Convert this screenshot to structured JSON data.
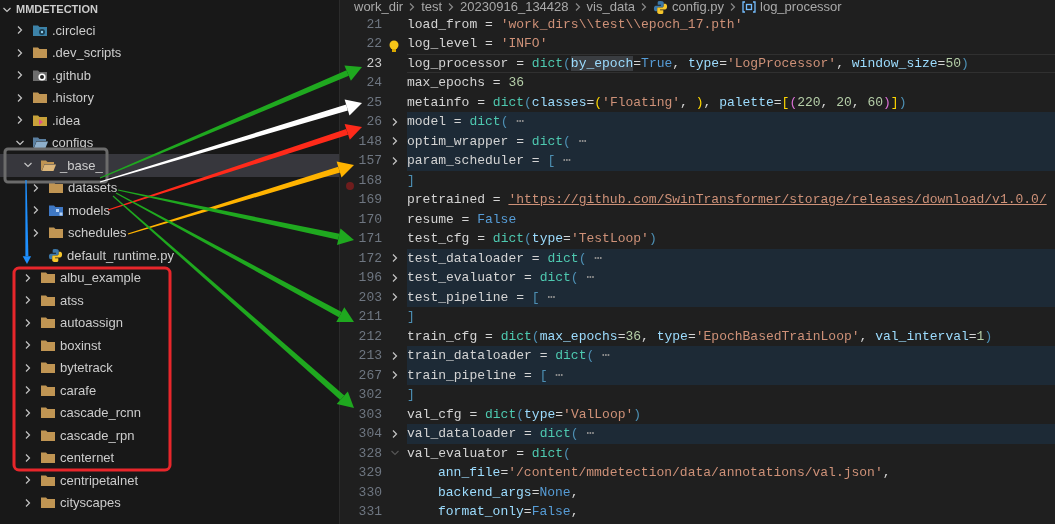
{
  "explorer": {
    "title": "MMDETECTION",
    "expanded": true,
    "items": [
      {
        "label": ".circleci",
        "kind": "folder-circleci",
        "expanded": false,
        "selected": false
      },
      {
        "label": ".dev_scripts",
        "kind": "folder",
        "expanded": false,
        "selected": false
      },
      {
        "label": ".github",
        "kind": "folder-github",
        "expanded": false,
        "selected": false
      },
      {
        "label": ".history",
        "kind": "folder",
        "expanded": false,
        "selected": false
      },
      {
        "label": ".idea",
        "kind": "folder-idea",
        "expanded": false,
        "selected": false
      },
      {
        "label": "configs",
        "kind": "folder-config",
        "expanded": true,
        "selected": false,
        "children": [
          {
            "label": "_base_",
            "kind": "folder",
            "expanded": true,
            "selected": true,
            "children": [
              {
                "label": "datasets",
                "kind": "folder",
                "expanded": false,
                "selected": false
              },
              {
                "label": "models",
                "kind": "folder-models",
                "expanded": false,
                "selected": false
              },
              {
                "label": "schedules",
                "kind": "folder",
                "expanded": false,
                "selected": false
              },
              {
                "label": "default_runtime.py",
                "kind": "python",
                "selected": false
              }
            ]
          },
          {
            "label": "albu_example",
            "kind": "folder",
            "expanded": false,
            "selected": false
          },
          {
            "label": "atss",
            "kind": "folder",
            "expanded": false,
            "selected": false
          },
          {
            "label": "autoassign",
            "kind": "folder",
            "expanded": false,
            "selected": false
          },
          {
            "label": "boxinst",
            "kind": "folder",
            "expanded": false,
            "selected": false
          },
          {
            "label": "bytetrack",
            "kind": "folder",
            "expanded": false,
            "selected": false
          },
          {
            "label": "carafe",
            "kind": "folder",
            "expanded": false,
            "selected": false
          },
          {
            "label": "cascade_rcnn",
            "kind": "folder",
            "expanded": false,
            "selected": false
          },
          {
            "label": "cascade_rpn",
            "kind": "folder",
            "expanded": false,
            "selected": false
          },
          {
            "label": "centernet",
            "kind": "folder",
            "expanded": false,
            "selected": false
          },
          {
            "label": "centripetalnet",
            "kind": "folder",
            "expanded": false,
            "selected": false
          },
          {
            "label": "cityscapes",
            "kind": "folder",
            "expanded": false,
            "selected": false
          }
        ]
      }
    ]
  },
  "breadcrumb": [
    {
      "label": "work_dir",
      "kind": "folder"
    },
    {
      "label": "test",
      "kind": "folder"
    },
    {
      "label": "20230916_134428",
      "kind": "folder"
    },
    {
      "label": "vis_data",
      "kind": "folder"
    },
    {
      "label": "config.py",
      "kind": "python"
    },
    {
      "label": "log_processor",
      "kind": "symbol"
    }
  ],
  "code": [
    {
      "number": "21",
      "segments": [
        {
          "kind": "n",
          "text": "load_from"
        },
        {
          "kind": "o",
          "text": " = "
        },
        {
          "kind": "s",
          "text": "'work_dirs\\\\test\\\\epoch_17.pth'"
        }
      ]
    },
    {
      "number": "22",
      "lightbulb": true,
      "segments": [
        {
          "kind": "n",
          "text": "log_level"
        },
        {
          "kind": "o",
          "text": " = "
        },
        {
          "kind": "s",
          "text": "'INFO'"
        }
      ]
    },
    {
      "number": "23",
      "current": true,
      "segments": [
        {
          "kind": "n",
          "text": "log_processor"
        },
        {
          "kind": "o",
          "text": " = "
        },
        {
          "kind": "f",
          "text": "dict"
        },
        {
          "kind": "b1",
          "text": "("
        },
        {
          "kind": "h",
          "text": "by_epoch"
        },
        {
          "kind": "o",
          "text": "="
        },
        {
          "kind": "k",
          "text": "True"
        },
        {
          "kind": "o",
          "text": ", "
        },
        {
          "kind": "a",
          "text": "type"
        },
        {
          "kind": "o",
          "text": "="
        },
        {
          "kind": "s",
          "text": "'LogProcessor'"
        },
        {
          "kind": "o",
          "text": ", "
        },
        {
          "kind": "a",
          "text": "window_size"
        },
        {
          "kind": "o",
          "text": "="
        },
        {
          "kind": "d",
          "text": "50"
        },
        {
          "kind": "b1",
          "text": ")"
        }
      ]
    },
    {
      "number": "24",
      "segments": [
        {
          "kind": "n",
          "text": "max_epochs"
        },
        {
          "kind": "o",
          "text": " = "
        },
        {
          "kind": "d",
          "text": "36"
        }
      ]
    },
    {
      "number": "25",
      "segments": [
        {
          "kind": "n",
          "text": "metainfo"
        },
        {
          "kind": "o",
          "text": " = "
        },
        {
          "kind": "f",
          "text": "dict"
        },
        {
          "kind": "b1",
          "text": "("
        },
        {
          "kind": "a",
          "text": "classes"
        },
        {
          "kind": "o",
          "text": "="
        },
        {
          "kind": "b2",
          "text": "("
        },
        {
          "kind": "s",
          "text": "'Floating'"
        },
        {
          "kind": "o",
          "text": ", "
        },
        {
          "kind": "b2",
          "text": ")"
        },
        {
          "kind": "o",
          "text": ", "
        },
        {
          "kind": "a",
          "text": "palette"
        },
        {
          "kind": "o",
          "text": "="
        },
        {
          "kind": "b2",
          "text": "["
        },
        {
          "kind": "b3",
          "text": "("
        },
        {
          "kind": "d",
          "text": "220"
        },
        {
          "kind": "o",
          "text": ", "
        },
        {
          "kind": "d",
          "text": "20"
        },
        {
          "kind": "o",
          "text": ", "
        },
        {
          "kind": "d",
          "text": "60"
        },
        {
          "kind": "b3",
          "text": ")"
        },
        {
          "kind": "b2",
          "text": "]"
        },
        {
          "kind": "b1",
          "text": ")"
        }
      ]
    },
    {
      "number": "26",
      "expanded": false,
      "segments": [
        {
          "kind": "n",
          "text": "model"
        },
        {
          "kind": "o",
          "text": " = "
        },
        {
          "kind": "f",
          "text": "dict"
        },
        {
          "kind": "b1",
          "text": "("
        },
        {
          "kind": "e",
          "text": " ⋯"
        }
      ]
    },
    {
      "number": "148",
      "expanded": false,
      "segments": [
        {
          "kind": "n",
          "text": "optim_wrapper"
        },
        {
          "kind": "o",
          "text": " = "
        },
        {
          "kind": "f",
          "text": "dict"
        },
        {
          "kind": "b1",
          "text": "("
        },
        {
          "kind": "e",
          "text": " ⋯"
        }
      ]
    },
    {
      "number": "157",
      "expanded": false,
      "segments": [
        {
          "kind": "n",
          "text": "param_scheduler"
        },
        {
          "kind": "o",
          "text": " = "
        },
        {
          "kind": "b1",
          "text": "["
        },
        {
          "kind": "e",
          "text": " ⋯"
        }
      ]
    },
    {
      "number": "168",
      "breakpoint": true,
      "segments": [
        {
          "kind": "b1",
          "text": "]"
        }
      ]
    },
    {
      "number": "169",
      "segments": [
        {
          "kind": "n",
          "text": "pretrained"
        },
        {
          "kind": "o",
          "text": " = "
        },
        {
          "kind": "u",
          "text": "'https://github.com/SwinTransformer/storage/releases/download/v1.0.0/"
        }
      ]
    },
    {
      "number": "170",
      "segments": [
        {
          "kind": "n",
          "text": "resume"
        },
        {
          "kind": "o",
          "text": " = "
        },
        {
          "kind": "k",
          "text": "False"
        }
      ]
    },
    {
      "number": "171",
      "segments": [
        {
          "kind": "n",
          "text": "test_cfg"
        },
        {
          "kind": "o",
          "text": " = "
        },
        {
          "kind": "f",
          "text": "dict"
        },
        {
          "kind": "b1",
          "text": "("
        },
        {
          "kind": "a",
          "text": "type"
        },
        {
          "kind": "o",
          "text": "="
        },
        {
          "kind": "s",
          "text": "'TestLoop'"
        },
        {
          "kind": "b1",
          "text": ")"
        }
      ]
    },
    {
      "number": "172",
      "expanded": false,
      "segments": [
        {
          "kind": "n",
          "text": "test_dataloader"
        },
        {
          "kind": "o",
          "text": " = "
        },
        {
          "kind": "f",
          "text": "dict"
        },
        {
          "kind": "b1",
          "text": "("
        },
        {
          "kind": "e",
          "text": " ⋯"
        }
      ]
    },
    {
      "number": "196",
      "expanded": false,
      "segments": [
        {
          "kind": "n",
          "text": "test_evaluator"
        },
        {
          "kind": "o",
          "text": " = "
        },
        {
          "kind": "f",
          "text": "dict"
        },
        {
          "kind": "b1",
          "text": "("
        },
        {
          "kind": "e",
          "text": " ⋯"
        }
      ]
    },
    {
      "number": "203",
      "expanded": false,
      "segments": [
        {
          "kind": "n",
          "text": "test_pipeline"
        },
        {
          "kind": "o",
          "text": " = "
        },
        {
          "kind": "b1",
          "text": "["
        },
        {
          "kind": "e",
          "text": " ⋯"
        }
      ]
    },
    {
      "number": "211",
      "segments": [
        {
          "kind": "b1",
          "text": "]"
        }
      ]
    },
    {
      "number": "212",
      "segments": [
        {
          "kind": "n",
          "text": "train_cfg"
        },
        {
          "kind": "o",
          "text": " = "
        },
        {
          "kind": "f",
          "text": "dict"
        },
        {
          "kind": "b1",
          "text": "("
        },
        {
          "kind": "a",
          "text": "max_epochs"
        },
        {
          "kind": "o",
          "text": "="
        },
        {
          "kind": "d",
          "text": "36"
        },
        {
          "kind": "o",
          "text": ", "
        },
        {
          "kind": "a",
          "text": "type"
        },
        {
          "kind": "o",
          "text": "="
        },
        {
          "kind": "s",
          "text": "'EpochBasedTrainLoop'"
        },
        {
          "kind": "o",
          "text": ", "
        },
        {
          "kind": "a",
          "text": "val_interval"
        },
        {
          "kind": "o",
          "text": "="
        },
        {
          "kind": "d",
          "text": "1"
        },
        {
          "kind": "b1",
          "text": ")"
        }
      ]
    },
    {
      "number": "213",
      "expanded": false,
      "segments": [
        {
          "kind": "n",
          "text": "train_dataloader"
        },
        {
          "kind": "o",
          "text": " = "
        },
        {
          "kind": "f",
          "text": "dict"
        },
        {
          "kind": "b1",
          "text": "("
        },
        {
          "kind": "e",
          "text": " ⋯"
        }
      ]
    },
    {
      "number": "267",
      "expanded": false,
      "segments": [
        {
          "kind": "n",
          "text": "train_pipeline"
        },
        {
          "kind": "o",
          "text": " = "
        },
        {
          "kind": "b1",
          "text": "["
        },
        {
          "kind": "e",
          "text": " ⋯"
        }
      ]
    },
    {
      "number": "302",
      "segments": [
        {
          "kind": "b1",
          "text": "]"
        }
      ]
    },
    {
      "number": "303",
      "segments": [
        {
          "kind": "n",
          "text": "val_cfg"
        },
        {
          "kind": "o",
          "text": " = "
        },
        {
          "kind": "f",
          "text": "dict"
        },
        {
          "kind": "b1",
          "text": "("
        },
        {
          "kind": "a",
          "text": "type"
        },
        {
          "kind": "o",
          "text": "="
        },
        {
          "kind": "s",
          "text": "'ValLoop'"
        },
        {
          "kind": "b1",
          "text": ")"
        }
      ]
    },
    {
      "number": "304",
      "expanded": false,
      "segments": [
        {
          "kind": "n",
          "text": "val_dataloader"
        },
        {
          "kind": "o",
          "text": " = "
        },
        {
          "kind": "f",
          "text": "dict"
        },
        {
          "kind": "b1",
          "text": "("
        },
        {
          "kind": "e",
          "text": " ⋯"
        }
      ]
    },
    {
      "number": "328",
      "expanded": true,
      "segments": [
        {
          "kind": "n",
          "text": "val_evaluator"
        },
        {
          "kind": "o",
          "text": " = "
        },
        {
          "kind": "f",
          "text": "dict"
        },
        {
          "kind": "b1",
          "text": "("
        }
      ]
    },
    {
      "number": "329",
      "indent": true,
      "segments": [
        {
          "kind": "a",
          "text": "ann_file"
        },
        {
          "kind": "o",
          "text": "="
        },
        {
          "kind": "s",
          "text": "'/content/mmdetection/data/annotations/val.json'"
        },
        {
          "kind": "o",
          "text": ","
        }
      ]
    },
    {
      "number": "330",
      "indent": true,
      "segments": [
        {
          "kind": "a",
          "text": "backend_args"
        },
        {
          "kind": "o",
          "text": "="
        },
        {
          "kind": "k",
          "text": "None"
        },
        {
          "kind": "o",
          "text": ","
        }
      ]
    },
    {
      "number": "331",
      "indent": true,
      "segments": [
        {
          "kind": "a",
          "text": "format_only"
        },
        {
          "kind": "o",
          "text": "="
        },
        {
          "kind": "k",
          "text": "False"
        },
        {
          "kind": "o",
          "text": ","
        }
      ]
    }
  ],
  "annotations": {
    "arrows": [
      {
        "color": "#1fa81f"
      },
      {
        "color": "#ffffff"
      },
      {
        "color": "#ff2a1a"
      },
      {
        "color": "#ffb300"
      },
      {
        "color": "#1fa81f"
      },
      {
        "color": "#1fa81f"
      },
      {
        "color": "#1fa81f"
      },
      {
        "color": "#1e90ff"
      }
    ],
    "boxes": [
      {
        "color": "#6b6b6b"
      },
      {
        "color": "#e8262b"
      }
    ]
  }
}
